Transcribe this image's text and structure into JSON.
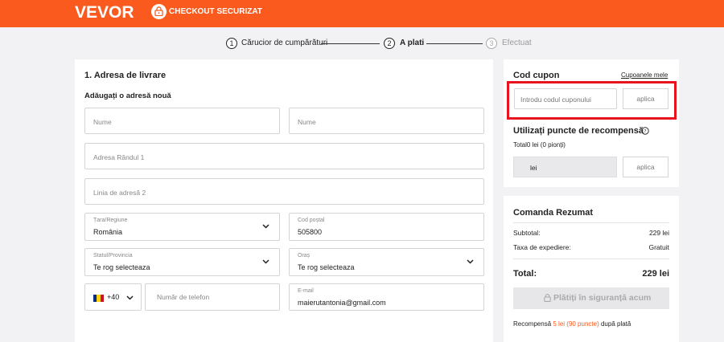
{
  "header": {
    "logo": "VEVOR",
    "secure_checkout": "CHECKOUT SECURIZAT",
    "brand_color": "#fa5a1e"
  },
  "steps": [
    {
      "num": "1",
      "label": "Cărucior de cumpărături",
      "state": "complete"
    },
    {
      "num": "2",
      "label": "A plati",
      "state": "current"
    },
    {
      "num": "3",
      "label": "Efectuat",
      "state": "pending"
    }
  ],
  "address": {
    "title": "1. Adresa de livrare",
    "subtitle": "Adăugați o adresă nouă",
    "first_name_ph": "Nume",
    "last_name_ph": "Nume",
    "line1_ph": "Adresa Rândul 1",
    "line2_ph": "Linia de adresă 2",
    "country_label": "Țara/Regiune",
    "country_value": "România",
    "postal_label": "Cod poștal",
    "postal_value": "505800",
    "state_label": "Statul/Provincia",
    "state_value": "Te rog selecteaza",
    "city_label": "Oraș",
    "city_value": "Te rog selecteaza",
    "phone_code": "+40",
    "phone_ph": "Număr de telefon",
    "email_label": "E-mail",
    "email_value": "maierutantonia@gmail.com"
  },
  "coupon": {
    "title": "Cod cupon",
    "my_coupons": "Cupoanele mele",
    "input_ph": "Introdu codul cuponului",
    "apply": "aplica"
  },
  "rewards": {
    "title": "Utilizați puncte de recompensă",
    "total": "Total0 lei (0 pionți)",
    "unit": "lei",
    "apply": "aplica"
  },
  "summary": {
    "title": "Comanda Rezumat",
    "subtotal_label": "Subtotal:",
    "subtotal_value": "229 lei",
    "shipping_label": "Taxa de expediere:",
    "shipping_value": "Gratuit",
    "total_label": "Total:",
    "total_value": "229 lei",
    "pay_button": "Plătiți în siguranță acum",
    "reward_prefix": "Recompensă",
    "reward_amount": "5 lei (90 puncte)",
    "reward_suffix": "după plată"
  }
}
